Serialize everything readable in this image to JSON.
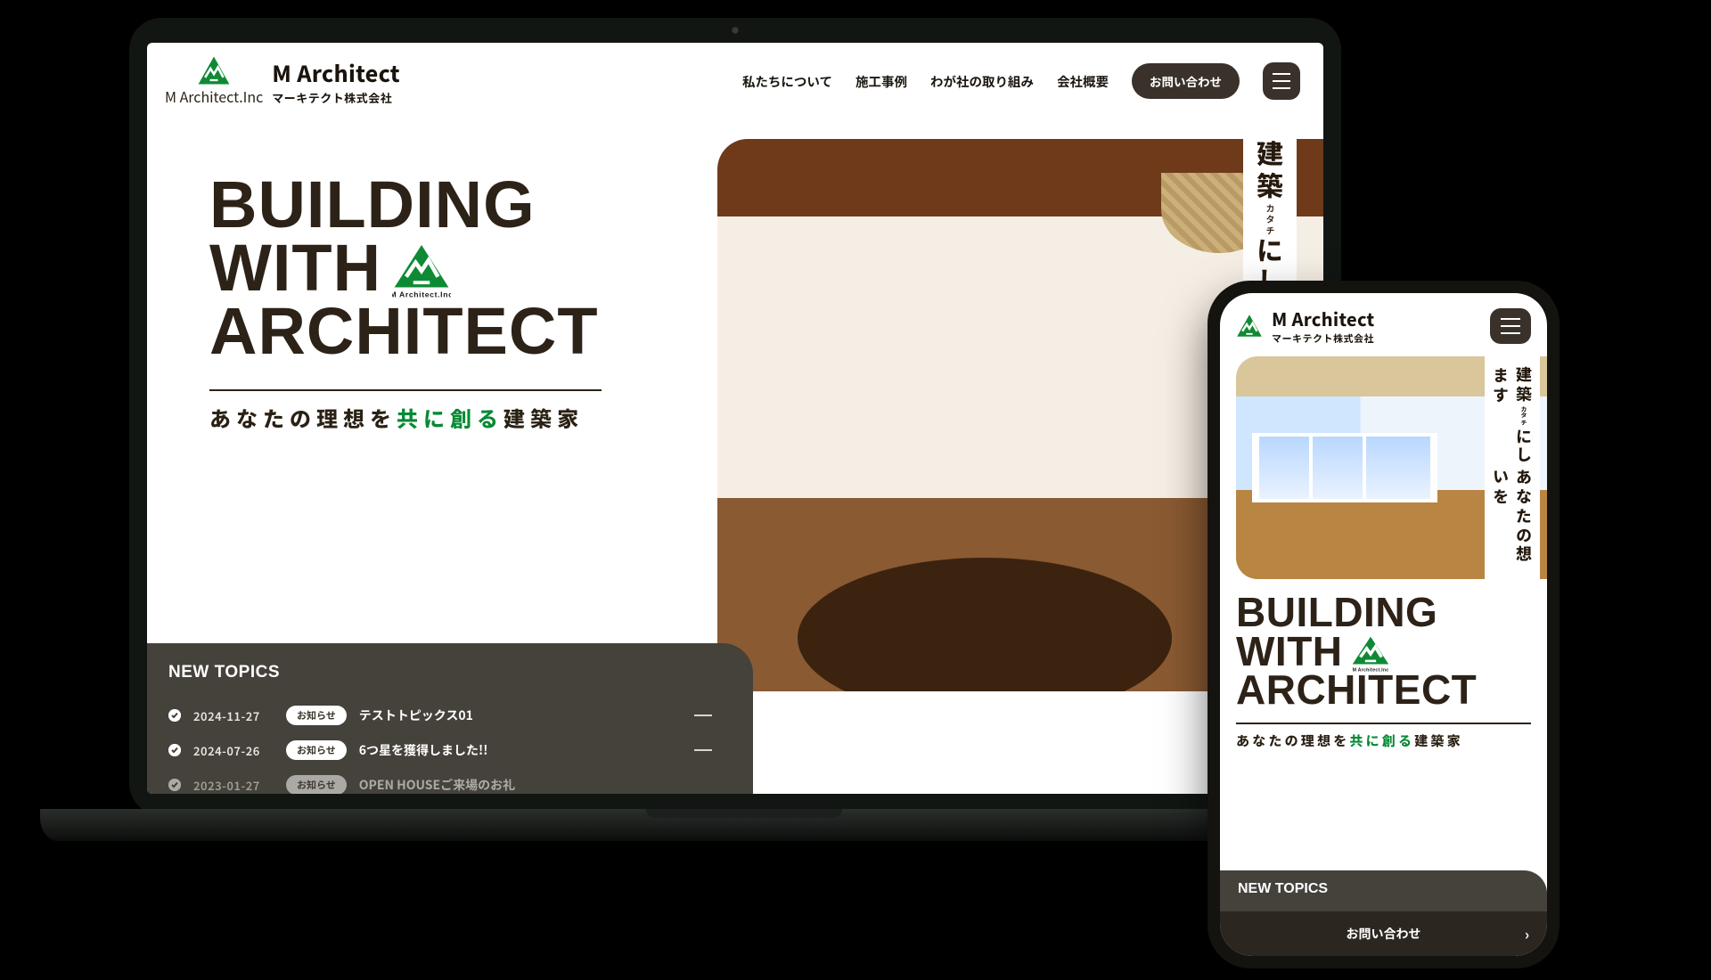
{
  "brand": {
    "name_en": "M Architect",
    "name_ja": "マーキテクト株式会社",
    "logo_caption": "M Architect.Inc"
  },
  "nav": {
    "items": [
      {
        "label": "私たちについて"
      },
      {
        "label": "施工事例"
      },
      {
        "label": "わが社の取り組み"
      },
      {
        "label": "会社概要"
      }
    ],
    "contact_label": "お問い合わせ"
  },
  "hero": {
    "title_line1": "BUILDING",
    "title_line2": "WITH",
    "title_line3": "ARCHITECT",
    "logo_caption": "M Architect.Inc",
    "sub_pre": "あなたの理想を",
    "sub_green": "共に創る",
    "sub_post": "建築家",
    "vertical_desktop": {
      "col1": "あなたの",
      "col2_pre": "建築",
      "col2_ruby": "カタチ",
      "col2_post": "にします"
    },
    "vertical_mobile": {
      "col1": "あなたの想いを",
      "col2_pre": "建築",
      "col2_ruby": "カタチ",
      "col2_post": "にします"
    }
  },
  "topics": {
    "heading": "NEW TOPICS",
    "items": [
      {
        "date": "2024-11-27",
        "badge": "お知らせ",
        "title": "テストトピックス01"
      },
      {
        "date": "2024-07-26",
        "badge": "お知らせ",
        "title": "6つ星を獲得しました!!"
      },
      {
        "date": "2023-01-27",
        "badge": "お知らせ",
        "title": "OPEN HOUSEご来場のお礼"
      }
    ]
  },
  "mobile": {
    "topics_heading": "NEW TOPICS",
    "contact_label": "お問い合わせ"
  },
  "colors": {
    "brand_green": "#088a34",
    "panel_dark": "#45413b",
    "ink": "#2c241a"
  }
}
